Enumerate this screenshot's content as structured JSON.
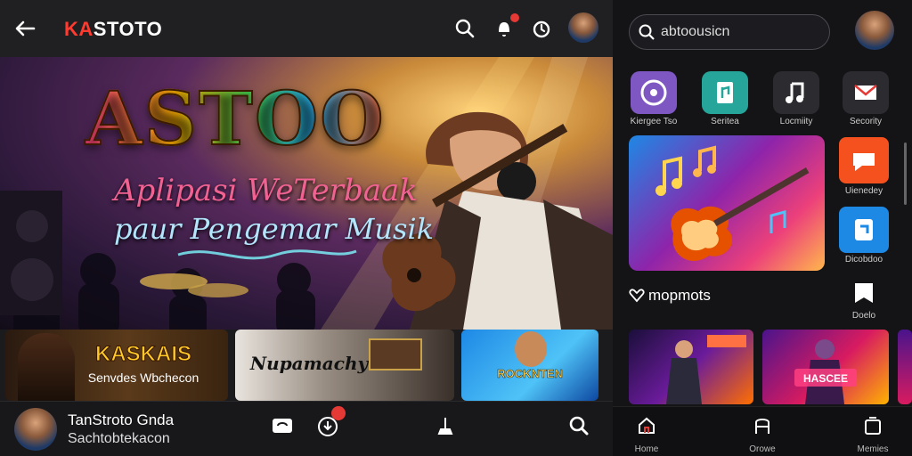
{
  "header": {
    "brand_prefix": "KA",
    "brand_rest": "STOTO",
    "icons": [
      "back-arrow-icon",
      "search-icon",
      "notification-icon",
      "history-icon"
    ]
  },
  "hero": {
    "title": "ASTOO",
    "subtitle_line1": "Aplipasi WeTerbaak",
    "subtitle_line2": "paur Pengemar Musik"
  },
  "thumbnails": [
    {
      "title": "KASKAIS",
      "subtitle": "Senvdes Wbchecon"
    },
    {
      "title": "Nupamachy",
      "subtitle": ""
    },
    {
      "title": "ROCKNTEN",
      "subtitle": ""
    }
  ],
  "player_bar": {
    "line1": "TanStroto Gnda",
    "line2": "Sachtobtekacon",
    "icons": [
      "loop-icon",
      "download-icon",
      "equalizer-icon",
      "search-icon"
    ],
    "badge_color": "#e53935"
  },
  "sidebar": {
    "search_text": "abtoousicn",
    "apps": [
      {
        "label": "Kiergee Tso",
        "icon": "disc-icon",
        "color": "#7e57c2"
      },
      {
        "label": "Seritea",
        "icon": "music-book-icon",
        "color": "#26a69a"
      },
      {
        "label": "Locmiity",
        "icon": "music-note-icon",
        "color": "#2b2b30"
      },
      {
        "label": "Secority",
        "icon": "mail-icon",
        "color": "#2b2b30"
      }
    ],
    "side_apps": [
      {
        "label": "Uienedey",
        "icon": "chat-icon",
        "color": "#f4511e"
      },
      {
        "label": "Dicobdoo",
        "icon": "share-icon",
        "color": "#1e88e5"
      },
      {
        "label": "Doelo",
        "icon": "flag-icon",
        "color": "#2b2b30"
      }
    ],
    "section_title": "mopmots",
    "games": [
      {
        "title": "",
        "subtitle": ""
      },
      {
        "title": "HASCEE",
        "subtitle": ""
      }
    ]
  },
  "bottom_nav": [
    {
      "label": "Home",
      "icon": "home-icon"
    },
    {
      "label": "Orowe",
      "icon": "library-icon"
    },
    {
      "label": "Memies",
      "icon": "queue-icon"
    }
  ],
  "colors": {
    "accent": "#ff3b30",
    "background": "#1b1b1d"
  }
}
